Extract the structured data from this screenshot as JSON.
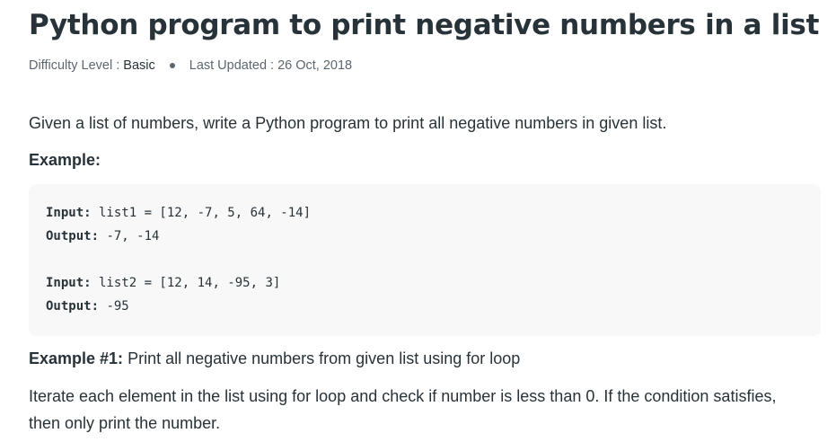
{
  "article": {
    "title": "Python program to print negative numbers in a list",
    "meta": {
      "difficulty_label": "Difficulty Level :",
      "difficulty_value": "Basic",
      "updated_label": "Last Updated :",
      "updated_value": "26 Oct, 2018"
    },
    "intro": "Given a list of numbers, write a Python program to print all negative numbers in given list.",
    "example_heading": "Example:",
    "code_lines": [
      {
        "label": "Input:",
        "value": " list1 = [12, -7, 5, 64, -14]"
      },
      {
        "label": "Output:",
        "value": " -7, -14"
      },
      {
        "label": "Input:",
        "value": " list2 = [12, 14, -95, 3]"
      },
      {
        "label": "Output:",
        "value": " -95"
      }
    ],
    "example1": {
      "label": "Example #1:",
      "text": " Print all negative numbers from given list using for loop"
    },
    "paragraph": "Iterate each element in the list using for loop and check if number is less than 0. If the condition satisfies, then only print the number."
  }
}
